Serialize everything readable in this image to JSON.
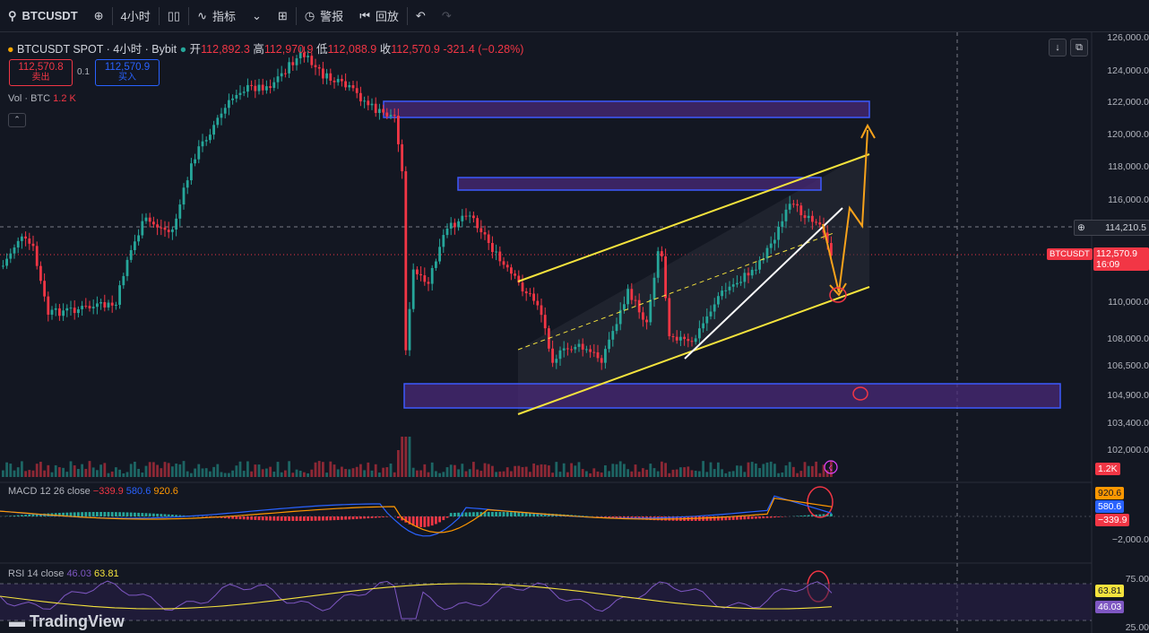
{
  "toolbar": {
    "symbol": "BTCUSDT",
    "interval": "4小时",
    "indicators": "指标",
    "alert": "警报",
    "replay": "回放"
  },
  "legend": {
    "symbol": "BTCUSDT SPOT · 4小时 · Bybit",
    "open_label": "开",
    "open": "112,892.3",
    "high_label": "高",
    "high": "112,970.9",
    "low_label": "低",
    "low": "112,088.9",
    "close_label": "收",
    "close": "112,570.9",
    "change": "-321.4 (−0.28%)"
  },
  "trade": {
    "sell_price": "112,570.8",
    "sell_label": "卖出",
    "spread": "0.1",
    "buy_price": "112,570.9",
    "buy_label": "买入"
  },
  "volume_legend": {
    "label": "Vol · BTC",
    "value": "1.2 K"
  },
  "macd_legend": {
    "label": "MACD 12 26 close",
    "hist": "−339.9",
    "macd": "580.6",
    "signal": "920.6"
  },
  "rsi_legend": {
    "label": "RSI 14 close",
    "rsi": "46.03",
    "ma": "63.81"
  },
  "price_axis": [
    "126,000.0",
    "124,000.0",
    "122,000.0",
    "120,000.0",
    "118,000.0",
    "116,000.0",
    "110,000.0",
    "108,000.0",
    "106,500.0",
    "104,900.0",
    "103,400.0",
    "102,000.0"
  ],
  "crosshair_price": "114,210.5",
  "last_price": {
    "symbol": "BTCUSDT",
    "price": "112,570.9",
    "countdown": "16:09"
  },
  "volume_tag": "1.2K",
  "macd_axis": {
    "signal": "920.6",
    "macd": "580.6",
    "hist": "−339.9",
    "tick": "−2,000.0"
  },
  "rsi_axis": {
    "top": "75.00",
    "ma": "63.81",
    "rsi": "46.03",
    "bottom": "25.00"
  },
  "brand": "TradingView",
  "colors": {
    "up": "#26a69a",
    "down": "#f23645",
    "zone": "#3d5afe",
    "channel": "#f5e33d",
    "arrow": "#f7a21b"
  }
}
